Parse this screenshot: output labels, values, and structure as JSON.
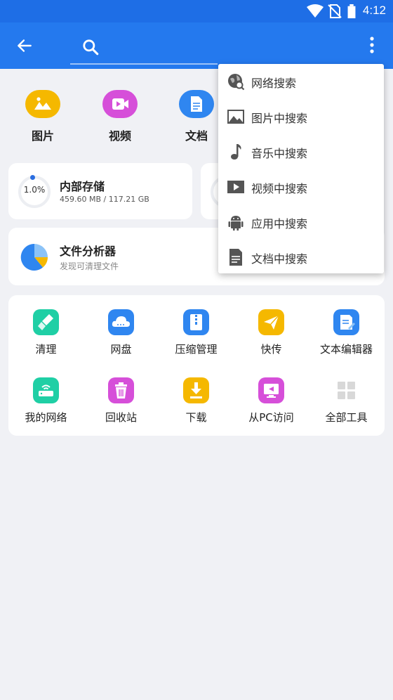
{
  "status_bar": {
    "time": "4:12"
  },
  "toolbar": {
    "search_placeholder": ""
  },
  "categories": [
    {
      "label": "图片",
      "color": "#f5b800",
      "icon": "image-icon"
    },
    {
      "label": "视频",
      "color": "#d64fd9",
      "icon": "video-icon"
    },
    {
      "label": "文档",
      "color": "#2f86f0",
      "icon": "document-icon"
    }
  ],
  "storage": {
    "percent": "1.0%",
    "title": "内部存储",
    "size": "459.60 MB / 117.21 GB"
  },
  "analyzer": {
    "title": "文件分析器",
    "subtitle": "发现可清理文件"
  },
  "tools": [
    {
      "label": "清理",
      "icon": "broom-icon",
      "color": "#1fcfa5"
    },
    {
      "label": "网盘",
      "icon": "cloud-icon",
      "color": "#2f86f0"
    },
    {
      "label": "压缩管理",
      "icon": "zip-icon",
      "color": "#2f86f0"
    },
    {
      "label": "快传",
      "icon": "send-icon",
      "color": "#f5b800"
    },
    {
      "label": "文本编辑器",
      "icon": "text-editor-icon",
      "color": "#2f86f0"
    },
    {
      "label": "我的网络",
      "icon": "router-icon",
      "color": "#1fcfa5"
    },
    {
      "label": "回收站",
      "icon": "trash-icon",
      "color": "#d64fd9"
    },
    {
      "label": "下载",
      "icon": "download-icon",
      "color": "#f5b800"
    },
    {
      "label": "从PC访问",
      "icon": "pc-access-icon",
      "color": "#d64fd9"
    },
    {
      "label": "全部工具",
      "icon": "grid-icon",
      "color": "#d8d8d8"
    }
  ],
  "search_menu": {
    "items": [
      {
        "label": "网络搜索",
        "icon": "web-search-icon"
      },
      {
        "label": "图片中搜索",
        "icon": "image-icon"
      },
      {
        "label": "音乐中搜索",
        "icon": "music-icon"
      },
      {
        "label": "视频中搜索",
        "icon": "video-play-icon"
      },
      {
        "label": "应用中搜索",
        "icon": "android-icon"
      },
      {
        "label": "文档中搜索",
        "icon": "document-icon"
      }
    ]
  }
}
